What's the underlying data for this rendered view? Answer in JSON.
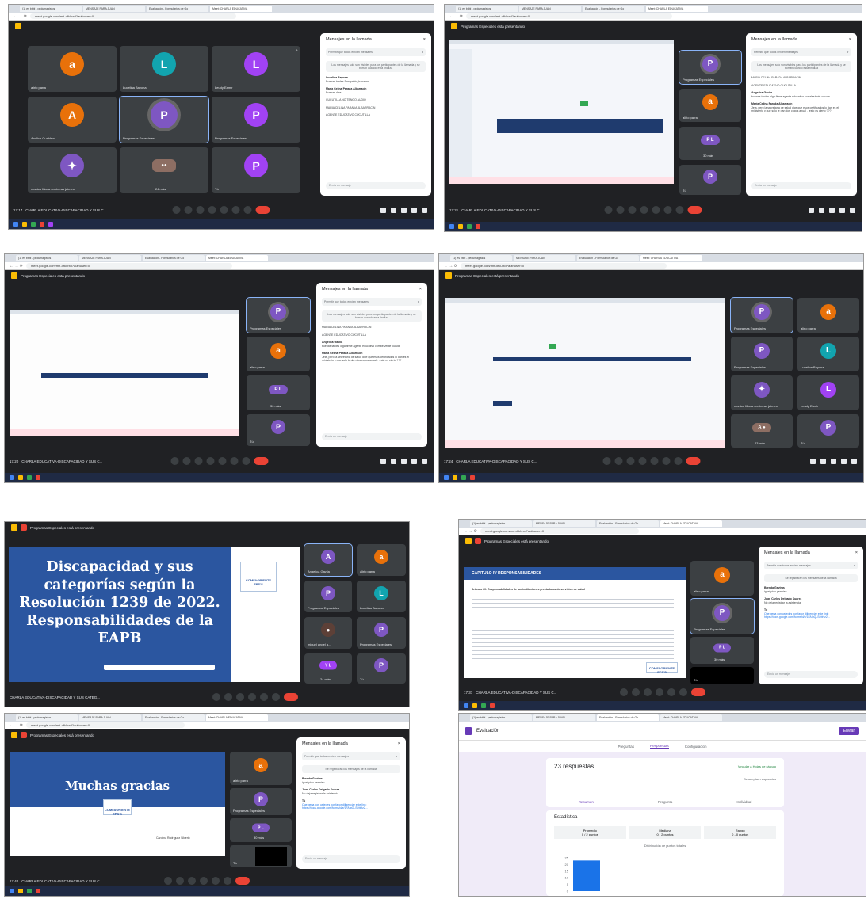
{
  "tabs": [
    "(1) es bitbl - pedumagistos",
    "MENSAJE PARA JUAN",
    "Evaluación - Formularios de Go",
    "Meet: CHARLA EDUCATIVA"
  ],
  "url": "meet.google.com/mri-dfkl-rxd?authuser=0",
  "meeting_name": "CHARLA EDUCATIVA-DISCAPACIDAD Y SUS C...",
  "meeting_name_full": "CHARLA EDUCATIVA-DISCAPACIDAD Y SUS CATEG...",
  "presenting": "Programas Especiales está presentando",
  "chat": {
    "title": "Mensajes en la llamada",
    "close": "×",
    "allow": "Permitir que todos envíen mensajes",
    "info": "Los mensajes solo son visibles para los participantes de la llamada y se borran cuando esta finaliza",
    "saved": "Se registrarán los mensajes de la llamada",
    "input": "Envía un mensaje",
    "m1": [
      {
        "who": "Lucelina Bayona",
        "time": "17:16",
        "text": "Buenas tardes San pablo_bananna"
      },
      {
        "who": "María Celina Parada Albarracín",
        "time": "17:15",
        "text": "Buenas días"
      },
      {
        "who": "",
        "time": "",
        "text": "CUCUTILLA NO TENGO AUDIO"
      },
      {
        "who": "",
        "time": "",
        "text": "MARIA CELINA PARADA ALBARRACIN"
      },
      {
        "who": "",
        "time": "",
        "text": "AGENTE EDUCATIVO CUCUTILLA"
      }
    ],
    "m2": [
      {
        "who": "",
        "time": "",
        "text": "MARIA CELINA PARADA ALBARRACIN"
      },
      {
        "who": "",
        "time": "",
        "text": "AGENTE EDUCATIVO CUCUTILLA"
      },
      {
        "who": "Angelica Gaviia",
        "time": "17:17",
        "text": "buenas tardes olga firme agente educativo corrales/ente cucuta"
      },
      {
        "who": "María Celina Parada Albarracín",
        "time": "17:17",
        "text": "Jefa, pero la secretaría de salud dice que esos certificados lo dan es el ministerio y que solo le dan dos cupos anual . .esto es cierto ???"
      }
    ],
    "m3": [
      {
        "who": "Brenda Gaviras",
        "time": "17:30",
        "text": "igual pido permiso"
      },
      {
        "who": "Juan Carlos Delgado Suárez",
        "time": "17:34",
        "text": "No deja registrar la asistencia"
      },
      {
        "who": "Tú",
        "time": "17:34",
        "text": "Que pena con ustedes por favor diligenciar este link: https://docs.google.com/forms/d/e/1FAIpQLSebHz2..."
      }
    ]
  },
  "times": [
    "17:17",
    "17:21",
    "17:20",
    "17:24",
    "17:37",
    "17:42"
  ],
  "tiles": {
    "alirio": "alirio parra",
    "lucelina": "Lucelina Bayona",
    "leudy": "Leudy Eamir",
    "analice": "Analice Gualdron",
    "prog": "Programas Especiales",
    "monica": "monica liliana contreras jaimes",
    "mas24": "24 más",
    "mas30": "30 más",
    "tu": "Tú",
    "angelica": "Angelica Gavila",
    "miguel": "miguel angel a...",
    "mas23": "23 más"
  },
  "slide": {
    "title": "Discapacidad y sus categorías según la Resolución 1239 de 2022. Responsabilidades de la EAPB",
    "logo": "COMFAORIENTE EPS'S",
    "chapter": "CAPITULO IV RESPONSABILIDADES",
    "art": "Artículo 20. Responsabilidades de las instituciones prestadoras de servicios de salud",
    "thanks": "Muchas gracias",
    "signer": "Carolina Rodríguez Silverio"
  },
  "forms": {
    "title": "Evaluación",
    "tabs": [
      "Preguntas",
      "Respuestas",
      "Configuración"
    ],
    "count": "23 respuestas",
    "link": "Vincular a Hojas de cálculo",
    "accepting": "Se aceptan respuestas",
    "sub": [
      "Resumen",
      "Pregunta",
      "Individual"
    ],
    "stats": "Estadística",
    "cols": [
      "Promedio",
      "Mediana",
      "Rango"
    ],
    "vals": [
      "0 / 2 puntos",
      "0 / 2 puntos",
      "0 - 0 puntos"
    ],
    "dist": "Distribución de puntos totales",
    "send": "Enviar",
    "yaxis": [
      "25",
      "20",
      "15",
      "10",
      "5",
      "0"
    ],
    "chart_data": {
      "type": "bar",
      "values": [
        23
      ]
    }
  },
  "colors": {
    "orange": "#e8710a",
    "teal": "#12a4af",
    "purple": "#a142f4",
    "violet": "#7e57c2",
    "blue": "#1a73e8",
    "slide": "#2b56a0"
  }
}
